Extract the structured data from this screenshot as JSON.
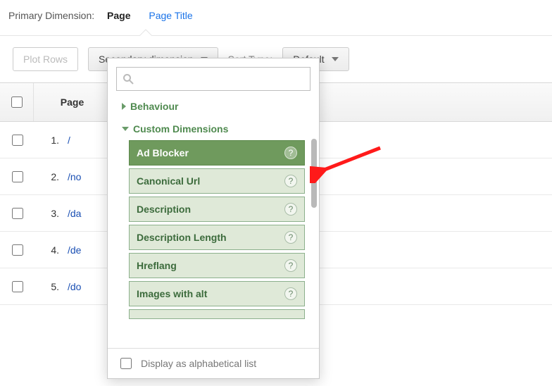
{
  "primary": {
    "label": "Primary Dimension:",
    "tabs": [
      {
        "label": "Page",
        "active": true
      },
      {
        "label": "Page Title",
        "active": false
      }
    ]
  },
  "toolbar": {
    "plot_rows": "Plot Rows",
    "secondary_dimension": "Secondary dimension",
    "sort_type_label": "Sort Type:",
    "sort_default": "Default"
  },
  "table": {
    "header_page": "Page",
    "rows": [
      {
        "idx": "1.",
        "path": "/"
      },
      {
        "idx": "2.",
        "path": "/no"
      },
      {
        "idx": "3.",
        "path": "/da"
      },
      {
        "idx": "4.",
        "path": "/de"
      },
      {
        "idx": "5.",
        "path": "/do"
      }
    ]
  },
  "dropdown": {
    "search_placeholder": "",
    "groups": [
      {
        "name": "Behaviour",
        "expanded": false
      },
      {
        "name": "Custom Dimensions",
        "expanded": true,
        "items": [
          {
            "label": "Ad Blocker",
            "selected": true
          },
          {
            "label": "Canonical Url",
            "selected": false
          },
          {
            "label": "Description",
            "selected": false
          },
          {
            "label": "Description Length",
            "selected": false
          },
          {
            "label": "Hreflang",
            "selected": false
          },
          {
            "label": "Images with alt",
            "selected": false
          }
        ]
      }
    ],
    "footer_label": "Display as alphabetical list"
  }
}
